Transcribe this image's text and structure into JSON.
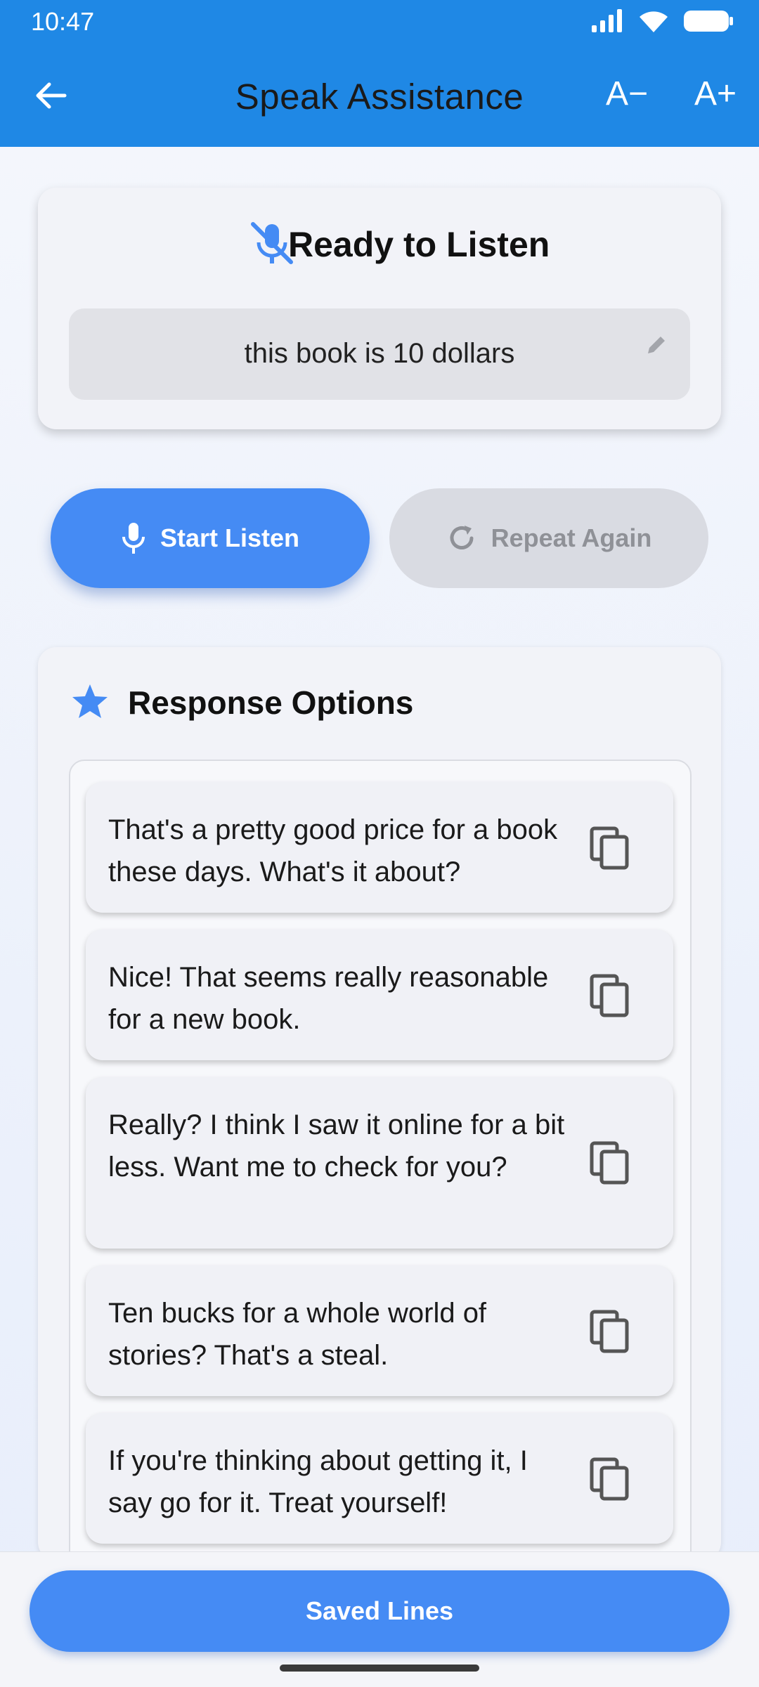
{
  "status_bar": {
    "time": "10:47"
  },
  "app_bar": {
    "title": "Speak Assistance",
    "font_decrease_label": "A−",
    "font_increase_label": "A+"
  },
  "listen_card": {
    "status": "Ready to Listen",
    "transcript": "this book is 10 dollars"
  },
  "actions": {
    "start_label": "Start Listen",
    "repeat_label": "Repeat Again"
  },
  "responses": {
    "title": "Response Options",
    "options": [
      "That's a pretty good price for a book these days. What's it about?",
      "Nice! That seems really reasonable for a new book.",
      "Really? I think I saw it online for a bit less. Want me to check for you?",
      "Ten bucks for a whole world of stories? That's a steal.",
      "If you're thinking about getting it, I say go for it. Treat yourself!"
    ]
  },
  "bottom": {
    "saved_label": "Saved Lines"
  },
  "colors": {
    "app_bar": "#1F88E5",
    "accent": "#458BF4",
    "disabled": "#D9DBE2"
  }
}
